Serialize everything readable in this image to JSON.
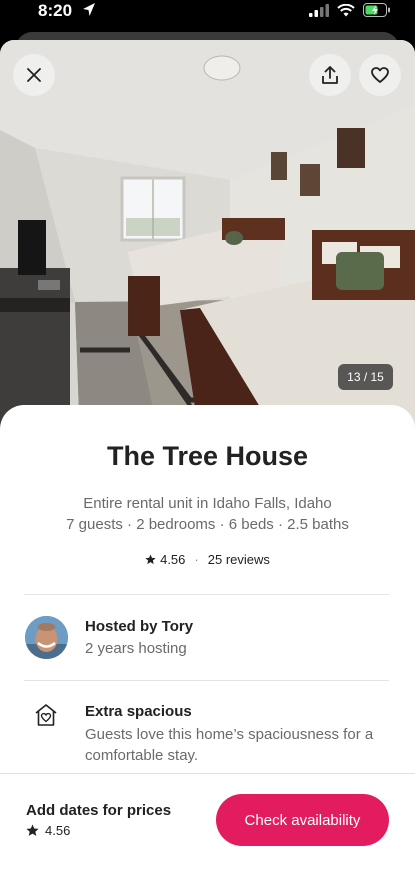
{
  "status_bar": {
    "time": "8:20"
  },
  "photo": {
    "counter": "13 / 15"
  },
  "listing": {
    "title": "The Tree House",
    "type_location": "Entire rental unit in Idaho Falls, Idaho",
    "details": "7 guests · 2 bedrooms · 6 beds · 2.5 baths",
    "rating": "4.56",
    "reviews": "25 reviews"
  },
  "host": {
    "name": "Hosted by Tory",
    "tenure": "2 years hosting"
  },
  "highlight": {
    "title": "Extra spacious",
    "description": "Guests love this home’s spaciousness for a comfortable stay."
  },
  "footer": {
    "label": "Add dates for prices",
    "rating": "4.56",
    "cta": "Check availability"
  },
  "colors": {
    "brand": "#e31c5f",
    "text": "#222222",
    "muted": "#6a6a6a"
  },
  "icons": [
    "location-arrow-icon",
    "signal-icon",
    "wifi-icon",
    "battery-icon",
    "close-icon",
    "share-icon",
    "heart-icon",
    "star-icon",
    "house-heart-icon"
  ]
}
